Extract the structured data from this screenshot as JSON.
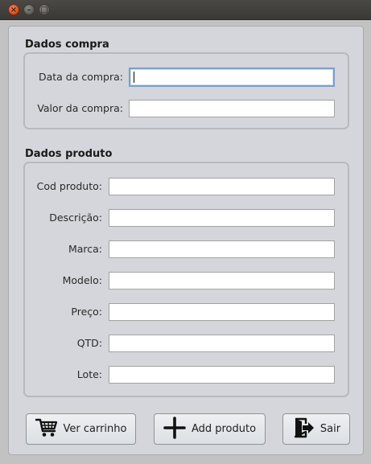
{
  "window": {
    "close_glyph": "×",
    "minimize_glyph": "–",
    "maximize_glyph": "□"
  },
  "compra": {
    "title": "Dados compra",
    "fields": [
      {
        "label": "Data da compra:",
        "value": ""
      },
      {
        "label": "Valor da compra:",
        "value": ""
      }
    ]
  },
  "produto": {
    "title": "Dados produto",
    "fields": [
      {
        "label": "Cod produto:",
        "value": ""
      },
      {
        "label": "Descrição:",
        "value": ""
      },
      {
        "label": "Marca:",
        "value": ""
      },
      {
        "label": "Modelo:",
        "value": ""
      },
      {
        "label": "Preço:",
        "value": ""
      },
      {
        "label": "QTD:",
        "value": ""
      },
      {
        "label": "Lote:",
        "value": ""
      }
    ]
  },
  "buttons": {
    "cart_label": "Ver carrinho",
    "cart_icon": "shopping-cart-icon",
    "add_label": "Add produto",
    "add_icon": "plus-icon",
    "exit_label": "Sair",
    "exit_icon": "exit-door-icon"
  },
  "colors": {
    "close_button": "#df4b16",
    "focus_ring": "#7aa0c9",
    "panel_bg": "#d4d6db"
  }
}
